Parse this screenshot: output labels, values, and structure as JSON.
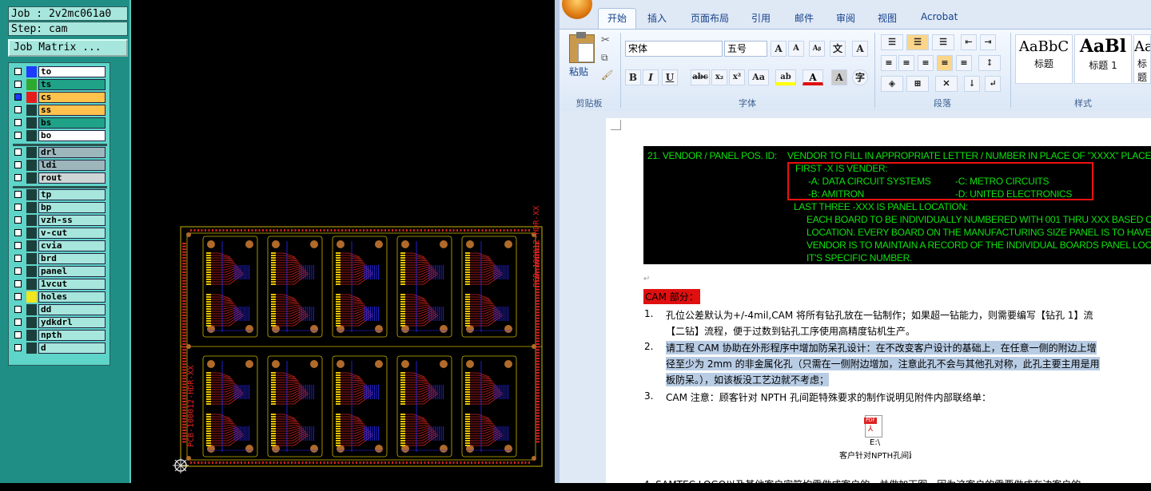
{
  "cam": {
    "job": "Job : 2v2mc061a0",
    "step": "Step: cam",
    "job_matrix": "Job Matrix ...",
    "layers": [
      {
        "name": "to",
        "color": "#1d3cff",
        "bg": "#ffffff",
        "checked": false
      },
      {
        "name": "ts",
        "color": "#2fa82f",
        "bg": "#1fa287",
        "checked": false
      },
      {
        "name": "cs",
        "color": "#e61c1c",
        "bg": "#ffc24d",
        "checked": true
      },
      {
        "name": "ss",
        "color": "#1d3f3c",
        "bg": "#ffc24d",
        "checked": false
      },
      {
        "name": "bs",
        "color": "#1d3f3c",
        "bg": "#1fa287",
        "checked": false
      },
      {
        "name": "bo",
        "color": "#1d3f3c",
        "bg": "#ffffff",
        "checked": false
      },
      {
        "name": "drl",
        "color": "#1d3f3c",
        "bg": "#9cb6bb",
        "checked": false
      },
      {
        "name": "ldi",
        "color": "#1d3f3c",
        "bg": "#9cb6bb",
        "checked": false
      },
      {
        "name": "rout",
        "color": "#1d3f3c",
        "bg": "#cfd6d6",
        "checked": false
      },
      {
        "name": "tp",
        "color": "#1d3f3c",
        "bg": "#a6e6dc",
        "checked": false
      },
      {
        "name": "bp",
        "color": "#1d3f3c",
        "bg": "#a6e6dc",
        "checked": false
      },
      {
        "name": "vzh-ss",
        "color": "#1d3f3c",
        "bg": "#a6e6dc",
        "checked": false
      },
      {
        "name": "v-cut",
        "color": "#1d3f3c",
        "bg": "#a6e6dc",
        "checked": false
      },
      {
        "name": "cvia",
        "color": "#1d3f3c",
        "bg": "#a6e6dc",
        "checked": false
      },
      {
        "name": "brd",
        "color": "#1d3f3c",
        "bg": "#a6e6dc",
        "checked": false
      },
      {
        "name": "panel",
        "color": "#1d3f3c",
        "bg": "#a6e6dc",
        "checked": false
      },
      {
        "name": "1vcut",
        "color": "#1d3f3c",
        "bg": "#a6e6dc",
        "checked": false
      },
      {
        "name": "holes",
        "color": "#f2e61c",
        "bg": "#a6e6dc",
        "checked": false
      },
      {
        "name": "dd",
        "color": "#1d3f3c",
        "bg": "#a6e6dc",
        "checked": false
      },
      {
        "name": "ydkdrl",
        "color": "#1d3f3c",
        "bg": "#a6e6dc",
        "checked": false
      },
      {
        "name": "npth",
        "color": "#1d3f3c",
        "bg": "#a6e6dc",
        "checked": false
      },
      {
        "name": "d",
        "color": "#1d3f3c",
        "bg": "#a6e6dc",
        "checked": false
      }
    ],
    "board_label_top": "PCB-100012-HDR-XX",
    "board_label_bottom": "PCB-100012-HDR-XX"
  },
  "word": {
    "tabs": [
      "开始",
      "插入",
      "页面布局",
      "引用",
      "邮件",
      "审阅",
      "视图",
      "Acrobat"
    ],
    "ribbon": {
      "paste_label": "粘贴",
      "font_name": "宋体",
      "font_size": "五号",
      "groups": [
        "剪贴板",
        "字体",
        "段落",
        "样式"
      ],
      "styles": [
        {
          "preview": "AaBbC",
          "name": "标题"
        },
        {
          "preview": "AaBl",
          "name": "标题 1"
        },
        {
          "preview": "Aa",
          "name": "标题"
        }
      ]
    },
    "doc": {
      "green_lines": [
        "21.  VENDOR / PANEL POS. ID:",
        "VENDOR TO FILL IN APPROPRIATE LETTER / NUMBER IN PLACE OF \"XXXX\" PLACEHOLDER",
        "FIRST -X IS VENDER:",
        "-A:  DATA CIRCUIT SYSTEMS",
        "-C:  METRO CIRCUITS",
        "-B:  AMITRON",
        "-D:  UNITED ELECTRONICS",
        "LAST THREE -XXX IS PANEL LOCATION:",
        "EACH BOARD TO BE  INDIVIDUALLY NUMBERED WITH 001 THRU XXX BASED ON IT'S P",
        "LOCATION.  EVERY BOARD ON THE MANUFACTURING SIZE PANEL IS TO HAVE A UNIQ",
        "VENDOR IS TO MAINTAIN A RECORD OF THE INDIVIDUAL BOARDS PANEL LOCATION B",
        "IT'S SPECIFIC NUMBER."
      ],
      "cam_heading": "CAM 部分：",
      "items": [
        {
          "num": "1.",
          "lines": [
            "孔位公差默认为+/-4mil,CAM 将所有钻孔放在一钻制作；如果超一钻能力，则需要编写【钻孔 1】流",
            "【二钻】流程，便于过数到钻孔工序使用高精度钻机生产。"
          ]
        },
        {
          "num": "2.",
          "lines": [
            "请工程 CAM 协助在外形程序中增加防呆孔设计：在不改变客户设计的基础上，在任意一侧的附边上增",
            "径至少为 2mm 的非金属化孔（只需在一侧附边增加，注意此孔不会与其他孔对称，此孔主要主用是用",
            "板防呆。），如该板没工艺边就不考虑；"
          ]
        },
        {
          "num": "3.",
          "lines": [
            "CAM 注意：顾客针对 NPTH 孔间距特殊要求的制作说明见附件内部联络单："
          ]
        }
      ],
      "attachment_icon": "PDF",
      "attachment_path": "E:\\",
      "attachment_name": "客户针对NPTH孔间距",
      "bottom_line": "4. SAMTEC LOGO以及其他客户字符均需做成客户的，并做加下图，因为这客户的需要做成在边客户的"
    }
  }
}
